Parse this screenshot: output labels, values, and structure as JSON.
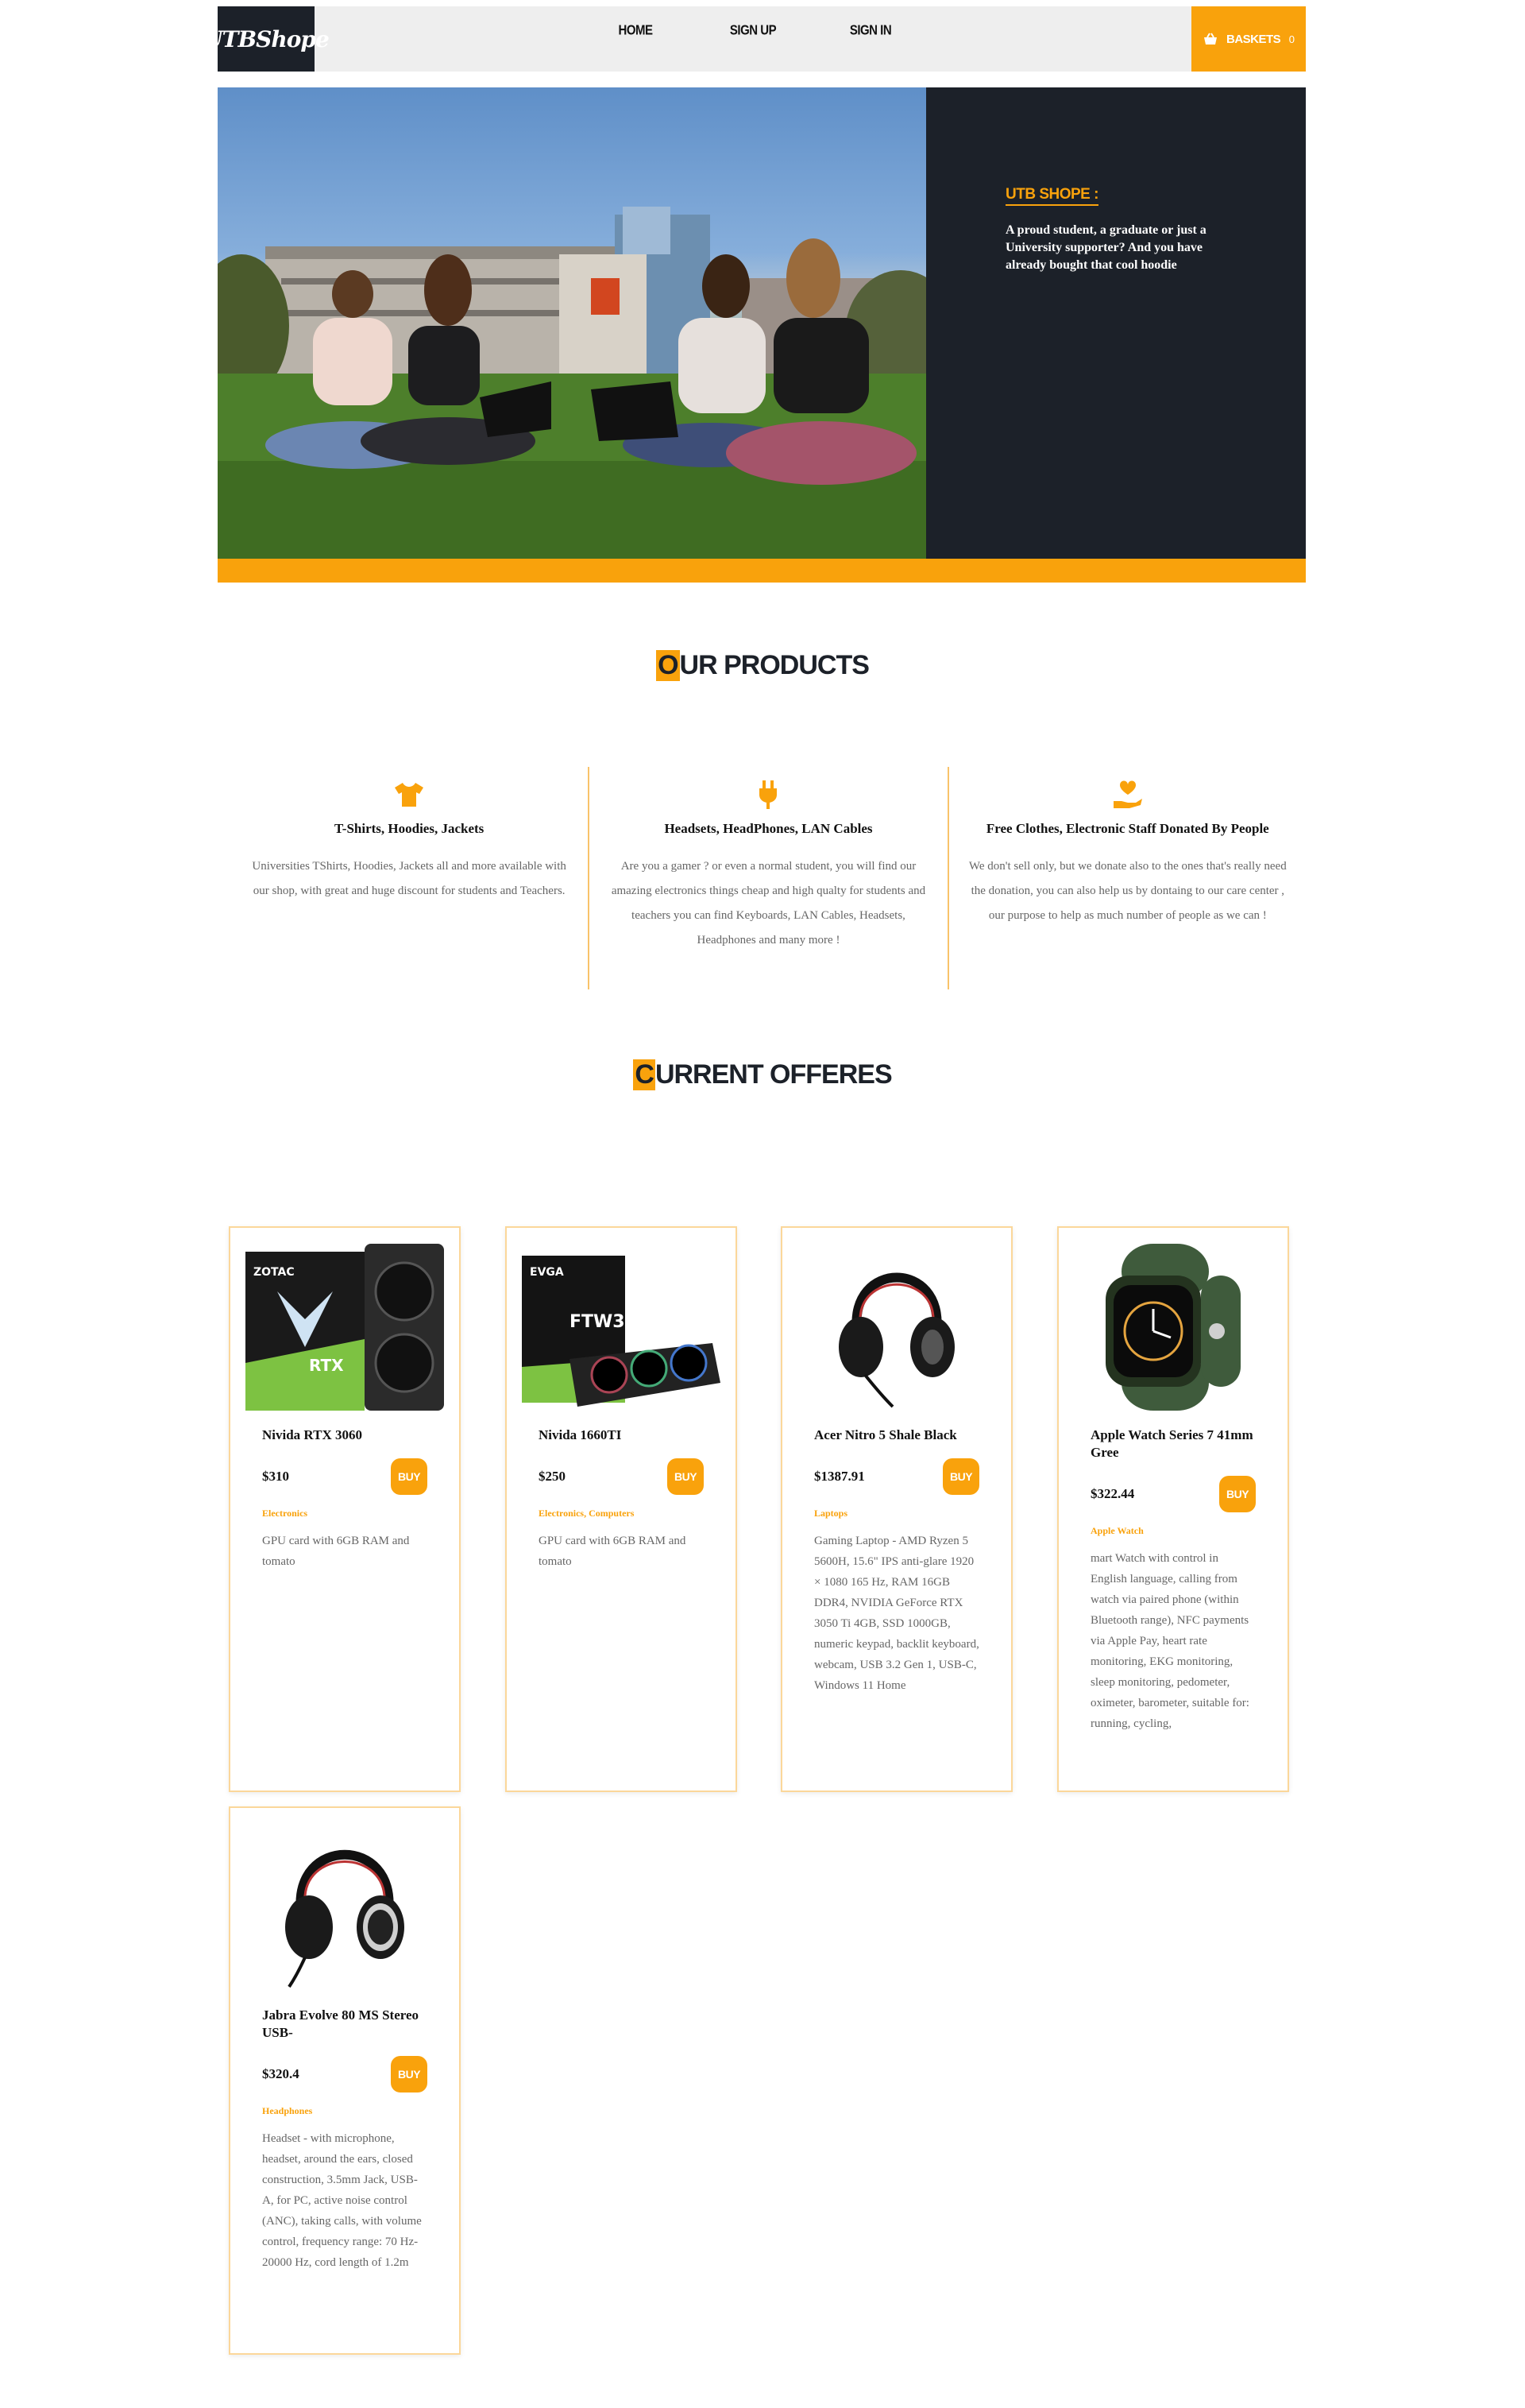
{
  "header": {
    "logo": "UTBShope",
    "nav": [
      "HOME",
      "SIGN UP",
      "SIGN IN"
    ],
    "basket_label": "BASKETS",
    "basket_count": "0"
  },
  "hero": {
    "title": "UTB SHOPE :",
    "description": "A proud student, a graduate or just a University supporter? And you have already bought that cool hoodie"
  },
  "products_section": {
    "title_first": "O",
    "title_rest": "UR PRODUCTS",
    "features": [
      {
        "icon": "tshirt-icon",
        "title": "T-Shirts, Hoodies, Jackets",
        "text": "Universities TShirts, Hoodies, Jackets all and more available with our shop, with great and huge discount for students and Teachers."
      },
      {
        "icon": "plug-icon",
        "title": "Headsets, HeadPhones, LAN Cables",
        "text": "Are you a gamer ? or even a normal student, you will find our amazing electronics things cheap and high qualty for students and teachers you can find Keyboards, LAN Cables, Headsets, Headphones and many more !"
      },
      {
        "icon": "donate-hand-heart-icon",
        "title": "Free Clothes, Electronic Staff Donated By People",
        "text": "We don't sell only, but we donate also to the ones that's really need the donation, you can also help us by dontaing to our care center , our purpose to help as much number of people as we can !"
      }
    ]
  },
  "offers_section": {
    "title_first": "C",
    "title_rest": "URRENT OFFERES",
    "buy_label": "BUY",
    "items": [
      {
        "name": "Nivida RTX 3060",
        "price": "$310",
        "category": "Electronics",
        "description": "GPU card with 6GB RAM and tomato",
        "image": "graphics-card-box-image"
      },
      {
        "name": "Nivida 1660TI",
        "price": "$250",
        "category": "Electronics, Computers",
        "description": "GPU card with 6GB RAM and tomato",
        "image": "graphics-card-box-image"
      },
      {
        "name": "Acer Nitro 5 Shale Black",
        "price": "$1387.91",
        "category": "Laptops",
        "description": "Gaming Laptop - AMD Ryzen 5 5600H, 15.6\" IPS anti-glare 1920 × 1080 165 Hz, RAM 16GB DDR4, NVIDIA GeForce RTX 3050 Ti 4GB, SSD 1000GB, numeric keypad, backlit keyboard, webcam, USB 3.2 Gen 1, USB-C, Windows 11 Home",
        "image": "headphones-image"
      },
      {
        "name": "Apple Watch Series 7 41mm Gree",
        "price": "$322.44",
        "category": "Apple Watch",
        "description": "mart Watch with control in English language, calling from watch via paired phone (within Bluetooth range), NFC payments via Apple Pay, heart rate monitoring, EKG monitoring, sleep monitoring, pedometer, oximeter, barometer, suitable for: running, cycling,",
        "image": "smartwatch-image"
      },
      {
        "name": "Jabra Evolve 80 MS Stereo USB-",
        "price": "$320.4",
        "category": "Headphones",
        "description": "Headset - with microphone, headset, around the ears, closed construction, 3.5mm Jack, USB-A, for PC, active noise control (ANC), taking calls, with volume control, frequency range: 70 Hz-20000 Hz, cord length of 1.2m",
        "image": "headphones-image"
      }
    ]
  },
  "colors": {
    "accent": "#f9a20c",
    "dark": "#1c2129"
  }
}
